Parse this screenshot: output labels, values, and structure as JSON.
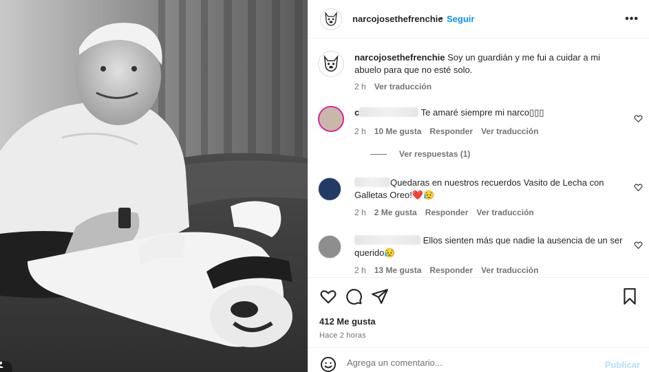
{
  "post": {
    "username": "narcojosethefrenchie",
    "dot": "•",
    "follow_label": "Seguir",
    "more_label": "•••"
  },
  "caption": {
    "username": "narcojosethefrenchie",
    "text": "Soy un guardián y me fui a cuidar a mi abuelo para que no esté solo.",
    "time": "2 h",
    "translate_label": "Ver traducción"
  },
  "comments": [
    {
      "user_prefix": "c",
      "text": "Te amaré siempre mi narco▯▯▯",
      "time": "2 h",
      "likes": "10 Me gusta",
      "reply_label": "Responder",
      "translate_label": "Ver traducción"
    },
    {
      "user_prefix": "",
      "text": "Quedaras en nuestros recuerdos Vasito de Lecha con Galletas Oreo!❤️😥",
      "time": "2 h",
      "likes": "2 Me gusta",
      "reply_label": "Responder",
      "translate_label": "Ver traducción"
    },
    {
      "user_prefix": "",
      "text": "Ellos sienten más que nadie la ausencia de un ser querido😥",
      "time": "2 h",
      "likes": "13 Me gusta",
      "reply_label": "Responder",
      "translate_label": "Ver traducción"
    }
  ],
  "view_replies_label": "Ver respuestas (1)",
  "engagement": {
    "likes": "412 Me gusta",
    "posted": "Hace 2 horas"
  },
  "add_comment": {
    "placeholder": "Agrega un comentario...",
    "publish_label": "Publicar"
  },
  "icons": {
    "like": "heart-icon",
    "comment": "comment-icon",
    "share": "send-icon",
    "save": "bookmark-icon",
    "emoji": "smiley-icon",
    "options": "more-icon"
  },
  "colors": {
    "follow": "#0095f6",
    "publish_disabled": "#b2dffc",
    "secondary_text": "#737373",
    "divider": "#efefef"
  }
}
